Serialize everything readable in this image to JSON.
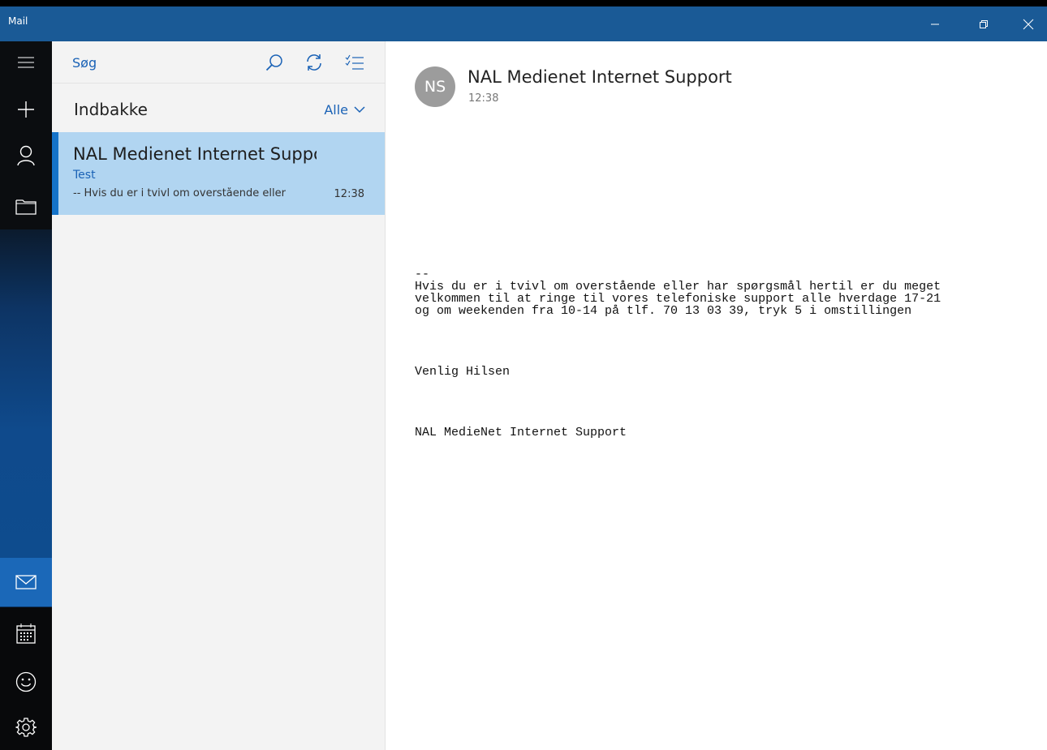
{
  "window": {
    "title": "Mail",
    "controls": [
      "minimize-icon",
      "restore-icon",
      "close-icon"
    ]
  },
  "colors": {
    "titlebar": "#1a5a96",
    "accent": "#1573c9",
    "selected_item_bg": "#b1d5f1",
    "link_blue": "#1a62b6"
  },
  "rail": {
    "top_items": [
      "hamburger-icon",
      "new-mail-icon",
      "accounts-icon",
      "folders-icon"
    ],
    "bottom_items": [
      "mail-icon",
      "calendar-icon",
      "feedback-icon",
      "settings-icon"
    ],
    "active_item": "mail-icon"
  },
  "list_pane": {
    "search_label": "Søg",
    "folder": "Indbakke",
    "filter": "Alle",
    "messages": [
      {
        "sender": "NAL Medienet Internet Support",
        "subject": "Test",
        "preview": "-- Hvis du er i tvivl om overstående eller",
        "time": "12:38",
        "selected": true
      }
    ]
  },
  "reading_pane": {
    "avatar_initials": "NS",
    "from": "NAL Medienet Internet Support",
    "time": "12:38",
    "body_lines": [
      "--",
      "Hvis du er i tvivl om overstående eller har spørgsmål hertil er du meget",
      "velkommen til at ringe til vores telefoniske support alle hverdage 17-21",
      "og om weekenden fra 10-14 på tlf. 70 13 03 39, tryk 5 i omstillingen",
      "",
      "",
      "",
      "",
      "Venlig Hilsen",
      "",
      "",
      "",
      "",
      "NAL MedieNet Internet Support"
    ]
  }
}
